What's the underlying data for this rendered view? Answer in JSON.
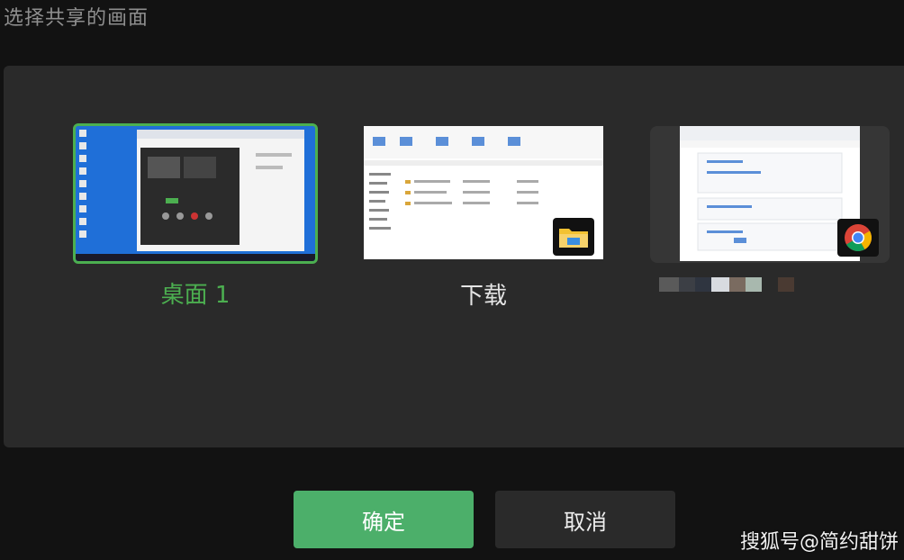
{
  "dialog": {
    "title": "选择共享的画面",
    "sources": [
      {
        "label": "桌面 1",
        "selected": true,
        "kind": "desktop"
      },
      {
        "label": "下载",
        "selected": false,
        "kind": "window",
        "app_icon": "folder-icon"
      },
      {
        "label": "",
        "selected": false,
        "kind": "window",
        "app_icon": "chrome-icon",
        "label_obscured": true
      }
    ],
    "buttons": {
      "confirm": "确定",
      "cancel": "取消"
    }
  },
  "watermark": "搜狐号@简约甜饼",
  "colors": {
    "accent": "#4caf50",
    "panel": "#2a2a2a",
    "background": "#121212",
    "confirm_bg": "#4caf6a"
  }
}
